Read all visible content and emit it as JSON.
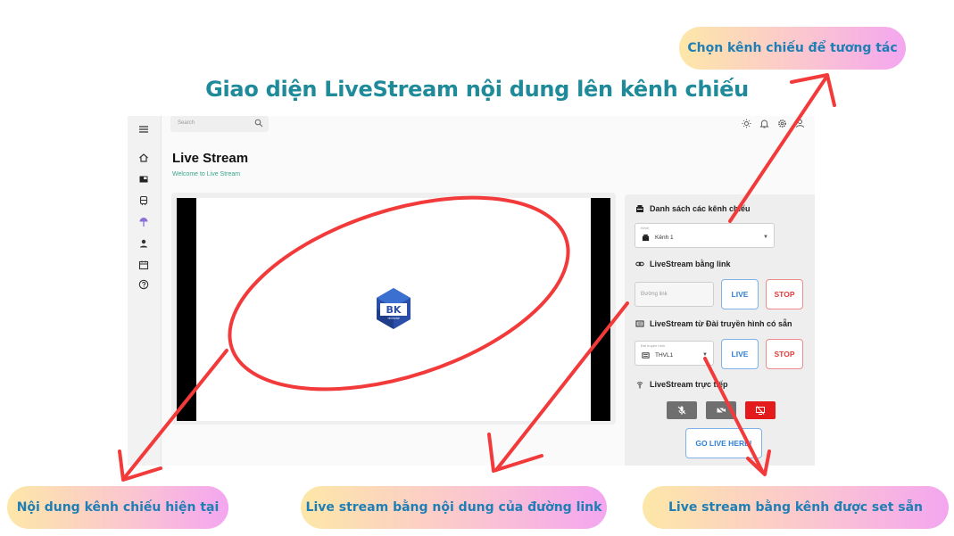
{
  "heading": "Giao diện LiveStream nội dung lên kênh chiếu",
  "callouts": {
    "top_right": "Chọn kênh chiếu để tương tác",
    "bottom_left": "Nội dung kênh chiếu hiện tại",
    "bottom_center": "Live stream bằng nội dung của đường link",
    "bottom_right": "Live stream bằng kênh được set sẵn"
  },
  "app": {
    "search_placeholder": "Search",
    "page_title": "Live Stream",
    "page_subtitle": "Welcome to Live Stream",
    "sidebar": [
      "menu-icon",
      "home-icon",
      "dashboard-icon",
      "train-icon",
      "broadcast-icon",
      "user-icon",
      "calendar-icon",
      "help-icon"
    ],
    "topbar_icons": [
      "sun-icon",
      "bell-icon",
      "settings-icon",
      "account-icon"
    ],
    "player_logo": {
      "text": "BK",
      "sub": "TECHWISE"
    },
    "panel": {
      "channels_label": "Danh sách các kênh chiếu",
      "channel_select_caption": "Kênh",
      "channel_select_value": "Kênh 1",
      "link_label": "LiveStream bằng link",
      "link_placeholder": "Đường link",
      "live_label": "LIVE",
      "stop_label": "STOP",
      "tv_label": "LiveStream từ Đài truyền hình có sẵn",
      "tv_select_caption": "Đài truyền hình",
      "tv_select_value": "THVL1",
      "direct_label": "LiveStream trực tiếp",
      "go_live_label": "GO LIVE HERE!"
    }
  },
  "colors": {
    "heading": "#1f8a9a",
    "callout_text": "#1f7fb5",
    "annotation_red": "#f23a3a",
    "live_blue": "#2f7fd7",
    "stop_red": "#e23b3b",
    "logo_blue": "#2b4fa8"
  }
}
